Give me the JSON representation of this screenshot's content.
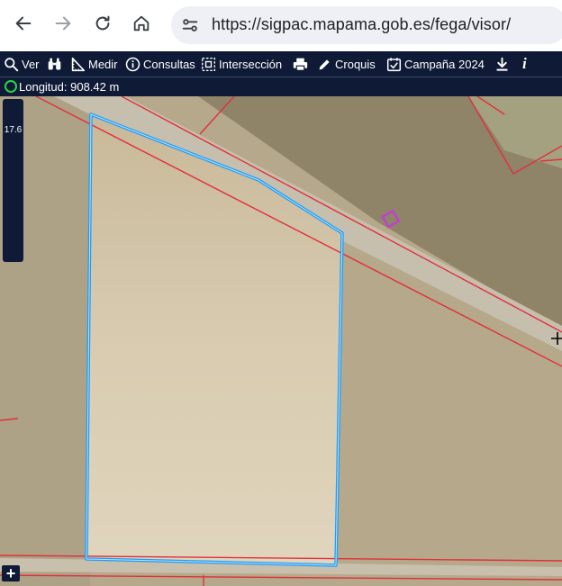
{
  "browser": {
    "url": "https://sigpac.mapama.gob.es/fega/visor/"
  },
  "toolbar": {
    "ver": "Ver",
    "medir": "Medir",
    "consultas": "Consultas",
    "interseccion": "Intersección",
    "croquis": "Croquis",
    "campana": "Campaña 2024",
    "info": "i"
  },
  "status": {
    "longitud": "Longitud: 908.42 m"
  },
  "map": {
    "zoom_level": "17.6"
  },
  "colors": {
    "toolbar_bg": "#0e1a36",
    "parcel_outline": "#1e9cf5",
    "boundary_lines": "#e0303c",
    "highlight_marker": "#c040d0"
  },
  "icons": {
    "back": "arrow-left-icon",
    "forward": "arrow-right-icon",
    "reload": "reload-icon",
    "home": "home-icon",
    "site_info": "tune-icon",
    "expand": "plus-icon"
  }
}
